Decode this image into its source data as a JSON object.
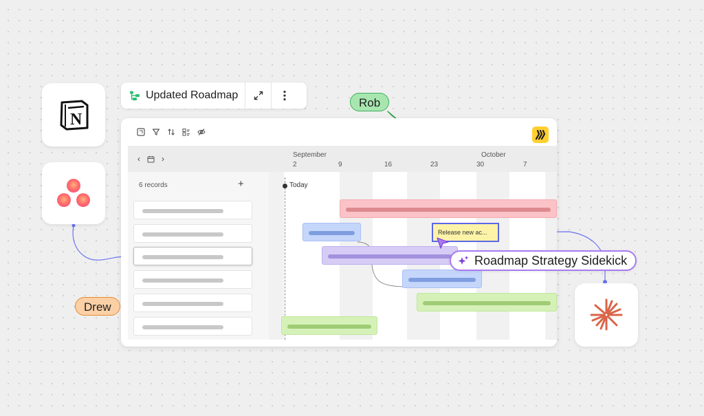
{
  "titlebar": {
    "title": "Updated Roadmap"
  },
  "apps": [
    {
      "name": "notion",
      "letter": "N"
    },
    {
      "name": "asana"
    },
    {
      "name": "claude"
    }
  ],
  "dates": {
    "months": [
      "September",
      "October"
    ],
    "days": [
      "2",
      "9",
      "16",
      "23",
      "30",
      "7"
    ]
  },
  "records": {
    "count_label": "6 records",
    "add_label": "+"
  },
  "timeline": {
    "today_label": "Today"
  },
  "sticky_note": "Release new ac...",
  "sidekick_label": "Roadmap Strategy Sidekick",
  "cursors": {
    "rob": "Rob",
    "drew": "Drew"
  },
  "colors": {
    "connector": "#6a72f0",
    "rob": "#a8e6b0",
    "drew": "#fbd0a6",
    "sidekick_border": "#a97af0",
    "miro_yellow": "#ffd02f"
  }
}
